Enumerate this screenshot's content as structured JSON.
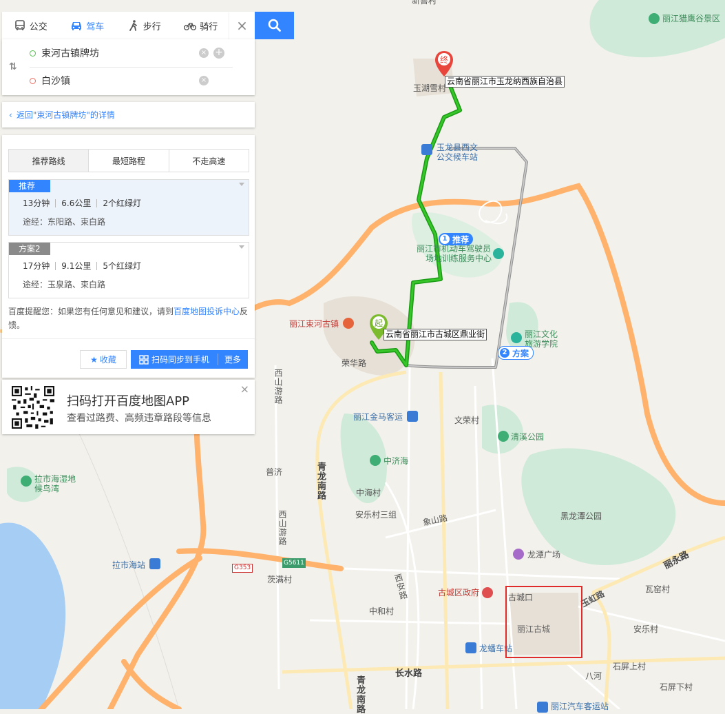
{
  "nav": {
    "tabs": [
      {
        "label": "公交",
        "icon": "bus-icon",
        "active": false
      },
      {
        "label": "驾车",
        "icon": "car-icon",
        "active": true
      },
      {
        "label": "步行",
        "icon": "walk-icon",
        "active": false
      },
      {
        "label": "骑行",
        "icon": "bike-icon",
        "active": false
      }
    ],
    "close_symbol": "×"
  },
  "route_inputs": {
    "from": "束河古镇牌坊",
    "to": "白沙镇",
    "swap_symbol": "⇅"
  },
  "back_link": "返回\"束河古镇牌坊\"的详情",
  "plan_tabs": [
    "推荐路线",
    "最短路程",
    "不走高速"
  ],
  "routes": [
    {
      "tag": "推荐",
      "time": "13分钟",
      "distance": "6.6公里",
      "lights": "2个红绿灯",
      "via": "途经：东阳路、束白路",
      "color": "#3385ff"
    },
    {
      "tag": "方案2",
      "time": "17分钟",
      "distance": "9.1公里",
      "lights": "5个红绿灯",
      "via": "途经：玉泉路、束白路",
      "color": "#8a8a8a"
    }
  ],
  "tip": {
    "pre": "百度提醒您：如果您有任何意见和建议，请到",
    "link": "百度地图投诉中心",
    "post": "反馈。"
  },
  "actions": {
    "favorite": "收藏",
    "sync": "扫码同步到手机",
    "more": "更多"
  },
  "qr": {
    "line1": "扫码打开百度地图APP",
    "line2": "查看过路费、高频违章路段等信息",
    "close": "×"
  },
  "map": {
    "start_marker": "起",
    "end_marker": "终",
    "start_callout": "云南省丽江市古城区鼎业街",
    "end_callout": "云南省丽江市玉龙纳西族自治县",
    "badge_recommended": {
      "num": "1",
      "label": "推荐"
    },
    "badge_plan2": {
      "num": "2",
      "label": "方案"
    },
    "labels": {
      "top_cut": "新善村",
      "yuhu": "玉湖雪村",
      "liejing": "丽江猎鹰谷景区",
      "busstation_1": "玉龙县西文",
      "busstation_2": "公交候车站",
      "driver_1": "丽江市机动车驾驶员",
      "driver_2": "场地训练服务中心",
      "shuhe": "丽江束河古镇",
      "culture_1": "丽江文化",
      "culture_2": "旅游学院",
      "ronghua": "荣华路",
      "xishan_1": "西山游路",
      "jinma": "丽江金马客运",
      "wenrong": "文荣村",
      "qingxi": "清溪公园",
      "zhongjihai": "中济海",
      "lashihai_wet_1": "拉市海湿地",
      "lashihai_wet_2": "候鸟湾",
      "puji": "普济",
      "qinglong_1": "青龙南路",
      "zhonghai": "中海村",
      "anle3": "安乐村三组",
      "xishan_2": "西山游路",
      "xiangshan": "象山路",
      "heilongtan": "黑龙潭公园",
      "longtan": "龙潭广场",
      "liyong": "丽永路",
      "lashihai_station": "拉市海站",
      "g5611": "G5611",
      "g353": "G353",
      "maoman": "茨满村",
      "xian": "西安路",
      "gov": "古城区政府",
      "guchengkou": "古城口",
      "yuhong": "玉虹路",
      "wayao": "瓦窑村",
      "zhonghe": "中和村",
      "oldtown": "丽江古城",
      "anle": "安乐村",
      "longfan": "龙蟠车站",
      "changshui": "长水路",
      "shipingshang": "石屏上村",
      "bahe": "八河",
      "shipingxia": "石屏下村",
      "qinglong_2": "青龙南路",
      "coach": "丽江汽车客运站"
    }
  }
}
